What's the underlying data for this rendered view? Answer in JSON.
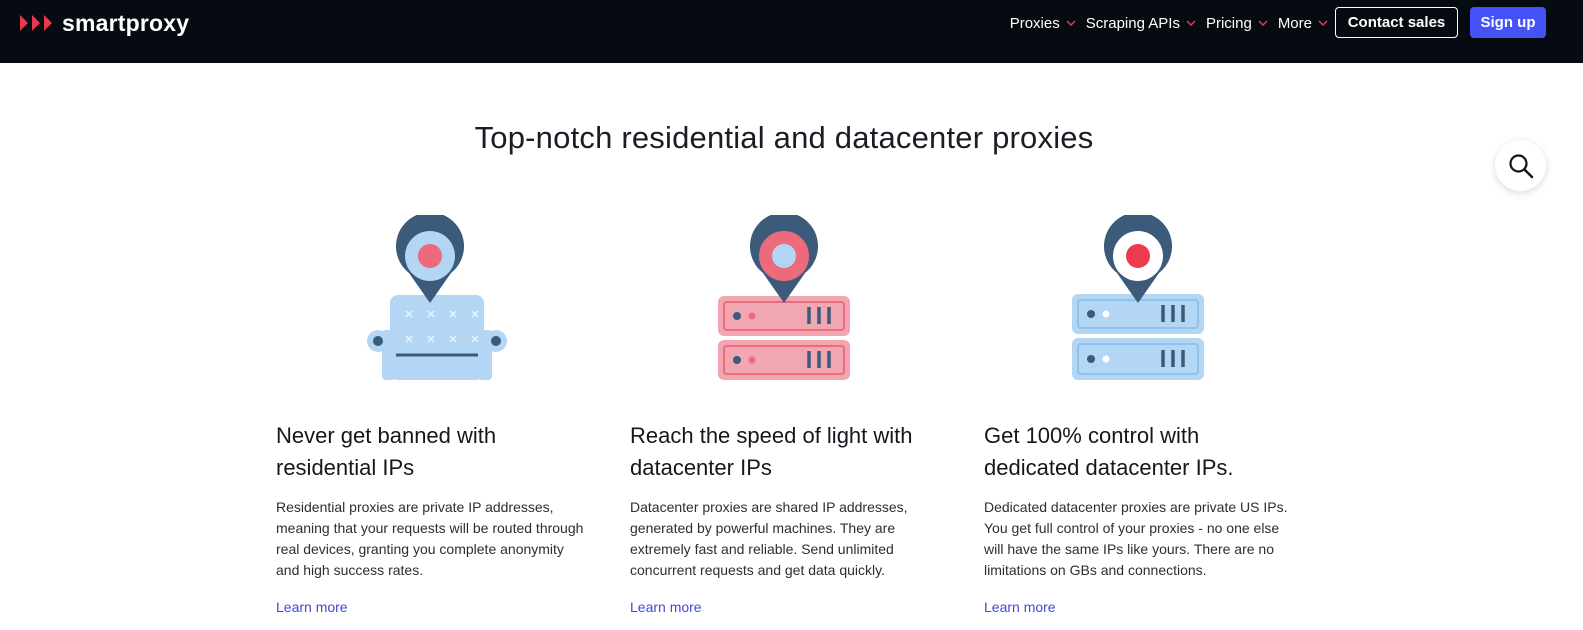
{
  "brand": {
    "name": "smartproxy",
    "accent": "#e8384f"
  },
  "nav": {
    "items": [
      {
        "label": "Proxies"
      },
      {
        "label": "Scraping APIs"
      },
      {
        "label": "Pricing"
      },
      {
        "label": "More"
      }
    ],
    "contact_label": "Contact sales",
    "signup_label": "Sign up"
  },
  "main": {
    "title": "Top-notch residential and datacenter proxies",
    "cards": [
      {
        "icon": "pinned-armchair-icon",
        "title": "Never get banned with residential IPs",
        "text": "Residential proxies are private IP addresses, meaning that your requests will be routed through real devices, granting you complete anonymity and high success rates.",
        "link": "Learn more"
      },
      {
        "icon": "pinned-red-server-icon",
        "title": "Reach the speed of light with datacenter IPs",
        "text": "Datacenter proxies are shared IP addresses, generated by powerful machines. They are extremely fast and reliable. Send unlimited concurrent requests and get data quickly.",
        "link": "Learn more"
      },
      {
        "icon": "pinned-blue-server-icon",
        "title": "Get 100% control with dedicated datacenter IPs.",
        "text": "Dedicated datacenter proxies are private US IPs. You get full control of your proxies - no one else will have the same IPs like yours. There are no limitations on GBs and connections.",
        "link": "Learn more"
      }
    ]
  },
  "colors": {
    "topbar": "#060b12",
    "signup": "#4552f6",
    "link": "#3f4ad6",
    "pin": "#3c5a7a",
    "light_blue": "#b3d6f5",
    "pink": "#f0a7b1",
    "red": "#ec6a7c"
  }
}
